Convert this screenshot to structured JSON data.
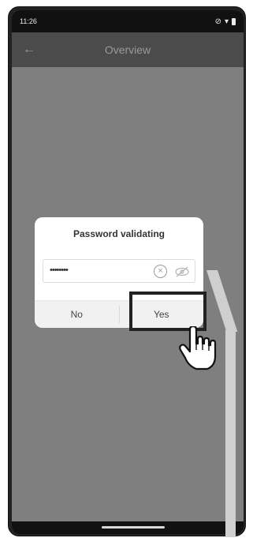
{
  "status_bar": {
    "time": "11:26",
    "icons": [
      "do-not-disturb-icon",
      "wifi-icon",
      "battery-icon"
    ]
  },
  "app_bar": {
    "title": "Overview",
    "back_icon": "arrow-left-icon"
  },
  "dialog": {
    "title": "Password validating",
    "password_value": "••••••••",
    "clear_icon": "clear-circle-icon",
    "visibility_icon": "eye-off-icon",
    "no_label": "No",
    "yes_label": "Yes"
  },
  "colors": {
    "overlay": "#7f7f7f",
    "app_bar": "#4b4b4b",
    "status_bar": "#111111",
    "dialog_bg": "#ffffff",
    "highlight": "#222222",
    "callout": "#cfcfcf"
  }
}
